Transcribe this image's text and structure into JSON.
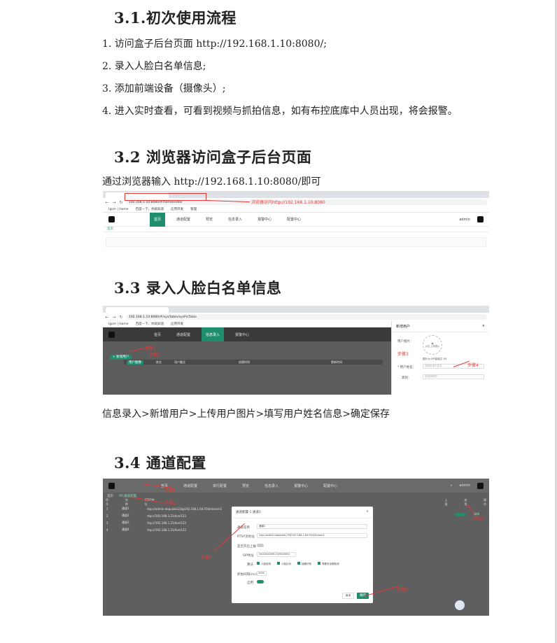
{
  "section1": {
    "title": "3.1.初次使用流程",
    "steps": [
      "1.  访问盒子后台页面 http://192.168.1.10:8080/;",
      "2.  录入人脸白名单信息;",
      "3.  添加前端设备（摄像头）;",
      "4.  进入实时查看，可看到视频与抓拍信息，如有布控底库中人员出现，将会报警。"
    ]
  },
  "section2": {
    "title": "3.2 浏览器访问盒子后台页面",
    "desc": "通过浏览器输入 http://192.168.1.10:8080/即可",
    "shot": {
      "url": "192.168.1.10:8080/#/home/index",
      "annotation": "浏览器访问http://192.168.1.10:8080",
      "bookmarks": [
        "Igsm | Home",
        "百度一下，你就知道",
        "应用开发",
        "管理"
      ],
      "menu": [
        "首页",
        "通道配置",
        "预览",
        "信息录入",
        "报警中心",
        "配置中心"
      ],
      "user": "admin",
      "breadcrumb": "首页"
    }
  },
  "section3": {
    "title": "3.3 录入人脸白名单信息",
    "desc": "信息录入>新增用户>上传用户图片>填写用户姓名信息>确定保存",
    "shot": {
      "url": "192.168.1.10:8080/#/sys/table/sysPicTable",
      "menu": [
        "首页",
        "通道配置",
        "信息录入",
        "报警中心"
      ],
      "add_btn": "+ 新增用户",
      "table_cols": [
        "用户图像",
        "姓名",
        "用户备注",
        "",
        "创建时间",
        "",
        "更新时间"
      ],
      "steps": [
        "步骤1",
        "步骤2",
        "步骤3",
        "步骤4"
      ],
      "dialog": {
        "title": "新增用户",
        "image_label": "用户图片：",
        "upload_text": "点击上传图片",
        "hint": "图片大小不能超过 1M",
        "name_label": "* 用户姓名：",
        "name_placeholder": "请填写用户姓名",
        "group_label": "类别：",
        "group_placeholder": "请选择类别"
      }
    }
  },
  "section4": {
    "title": "3.4 通道配置",
    "shot": {
      "menu": [
        "首页",
        "通道配置",
        "单行配置",
        "预览",
        "信息录入",
        "报警中心",
        "配置中心"
      ],
      "user": "admin",
      "breadcrumb": [
        "首页",
        "IPC通道配置"
      ],
      "table_cols": [
        "序号",
        "名称",
        "RTSP地址",
        "",
        "",
        "",
        "",
        "",
        "上报",
        "启用",
        "操作"
      ],
      "rows": [
        {
          "no": "1",
          "name": "通道1",
          "url": "rtsp://admin:daqulab123@192.168.1.64:554/stream1"
        },
        {
          "no": "2",
          "name": "通道2",
          "url": "rtsp://192.168.1.21/live/123"
        },
        {
          "no": "3",
          "name": "通道3",
          "url": "rtsp://192.168.1.21/live/123"
        },
        {
          "no": "4",
          "name": "通道4",
          "url": "rtsp://192.168.1.21/live/123"
        }
      ],
      "row_action": "编辑",
      "steps": [
        "步骤1",
        "步骤2",
        "步骤3",
        "步骤4",
        "步骤5"
      ],
      "dialog": {
        "title": "通道配置-1 通道1",
        "name_label": "通道名称",
        "name_value": "通道1",
        "rtsp_label": "RTSP流地址",
        "rtsp_value": "rtsp://admin:daqulab123@192.168.1.64:554/stream1",
        "report_label": "是否开启上报",
        "ip_label": "SIP地址",
        "ip_value": "34020000001320000001",
        "algo_label": "算法",
        "algos": [
          "人脸检测",
          "人脸比对",
          "抽烟识别",
          "佩戴安全帽检测"
        ],
        "interval_label": "抓拍间隔(ms)",
        "interval_value": "2000",
        "enable_label": "启用",
        "cancel": "取消",
        "ok": "确定"
      }
    }
  }
}
